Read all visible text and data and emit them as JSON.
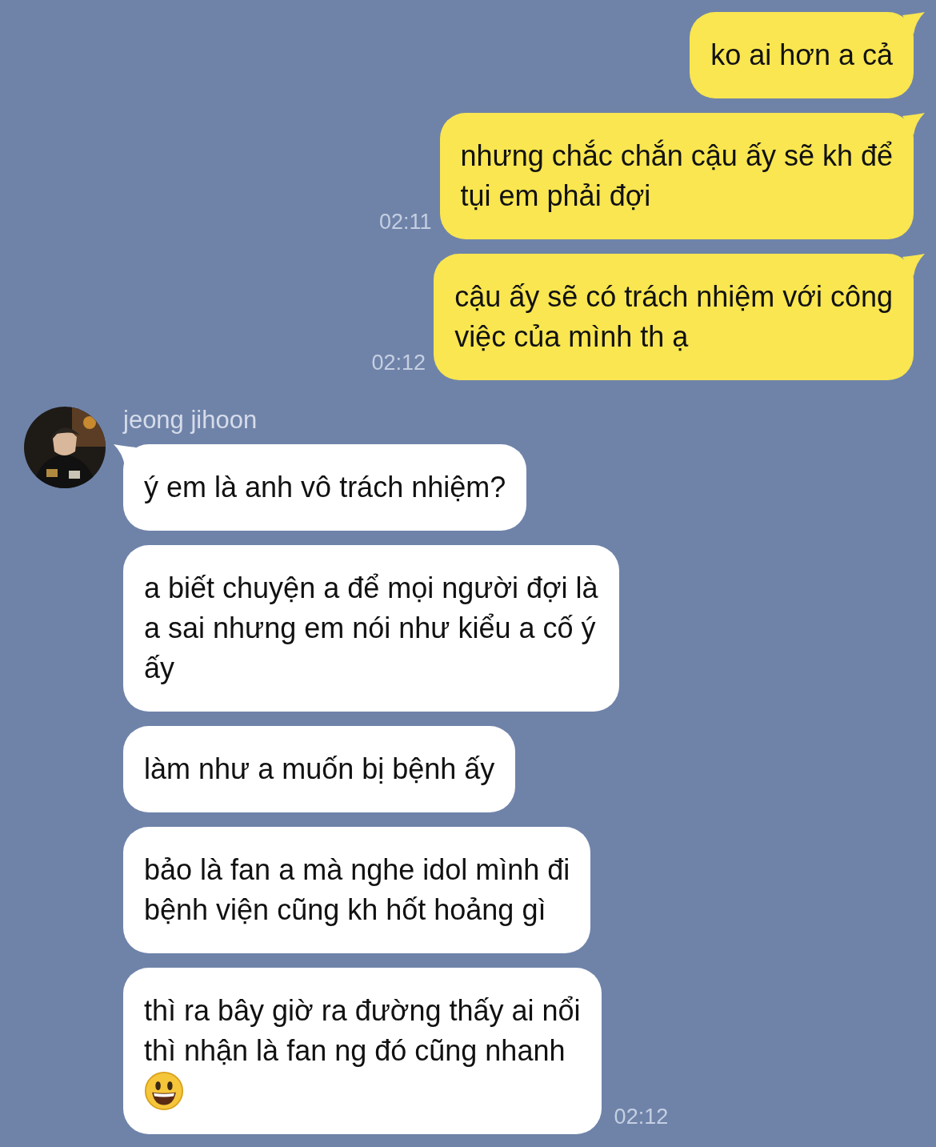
{
  "outgoing": [
    {
      "text": "ko ai hơn a cả",
      "tail": true
    },
    {
      "text": "nhưng chắc chắn cậu ấy sẽ kh để\ntụi em phải đợi",
      "time": "02:11",
      "tail": true
    },
    {
      "text": "cậu ấy sẽ có trách nhiệm với công\nviệc của mình th ạ",
      "time": "02:12",
      "tail": true
    }
  ],
  "incoming": {
    "sender": "jeong jihoon",
    "messages": [
      {
        "text": "ý em là anh vô trách nhiệm?",
        "tail": true
      },
      {
        "text": "a biết chuyện a để mọi người đợi là\na sai nhưng em nói như kiểu a cố ý\nấy",
        "tail": false
      },
      {
        "text": "làm như a muốn bị bệnh ấy",
        "tail": false
      },
      {
        "text": "bảo là fan a mà nghe idol mình đi\nbệnh viện cũng kh hốt hoảng gì",
        "tail": false
      },
      {
        "text": "thì ra bây giờ ra đường thấy ai nổi\nthì nhận là fan ng đó cũng nhanh",
        "smiley": true,
        "tail": false,
        "time": "02:12"
      }
    ]
  }
}
